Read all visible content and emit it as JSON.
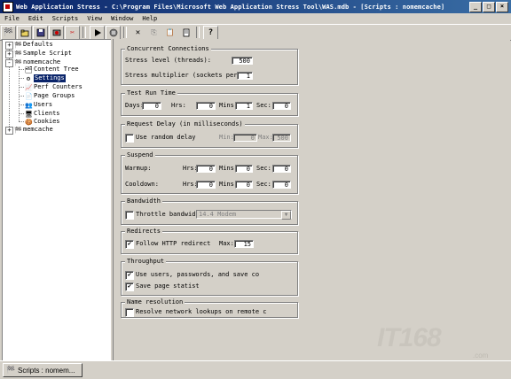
{
  "window": {
    "title": "Web Application Stress - C:\\Program Files\\Microsoft Web Application Stress Tool\\WAS.mdb - [Scripts : nomemcache]",
    "controls": [
      "_",
      "□",
      "×"
    ]
  },
  "menubar": {
    "items": [
      "File",
      "Edit",
      "Scripts",
      "View",
      "Window",
      "Help"
    ]
  },
  "toolbar": {
    "icons": [
      "new-script-icon",
      "open-icon",
      "save-icon",
      "record-icon",
      "cut-icon",
      "run-icon",
      "stop-icon",
      "delete-icon",
      "copy-icon",
      "paste-icon",
      "properties-icon",
      "help-icon"
    ]
  },
  "tree": {
    "items": [
      {
        "label": "Defaults",
        "level": 0,
        "expander": "+"
      },
      {
        "label": "Sample Script",
        "level": 0,
        "expander": "+"
      },
      {
        "label": "nomemcache",
        "level": 0,
        "expander": "-"
      },
      {
        "label": "Content Tree",
        "level": 1
      },
      {
        "label": "Settings",
        "level": 1,
        "selected": true
      },
      {
        "label": "Perf Counters",
        "level": 1
      },
      {
        "label": "Page Groups",
        "level": 1
      },
      {
        "label": "Users",
        "level": 1
      },
      {
        "label": "Clients",
        "level": 1
      },
      {
        "label": "Cookies",
        "level": 1
      },
      {
        "label": "memcache",
        "level": 0,
        "expander": "+"
      }
    ]
  },
  "settings": {
    "concurrent": {
      "title": "Concurrent Connections",
      "stress_label": "Stress level (threads):",
      "stress_value": "500",
      "multiplier_label": "Stress multiplier (sockets per",
      "multiplier_value": "1"
    },
    "runtime": {
      "title": "Test Run Time",
      "days_label": "Days:",
      "days": "0",
      "hrs_label": "Hrs:",
      "hrs": "0",
      "mins_label": "Mins:",
      "mins": "1",
      "sec_label": "Sec:",
      "sec": "0"
    },
    "delay": {
      "title": "Request Delay (in milliseconds)",
      "random_label": "Use random delay",
      "min_label": "Min:",
      "min": "0",
      "max_label": "Max:",
      "max": "500"
    },
    "suspend": {
      "title": "Suspend",
      "warmup_label": "Warmup:",
      "cooldown_label": "Cooldown:",
      "hrs_label": "Hrs:",
      "mins_label": "Mins:",
      "sec_label": "Sec:",
      "warmup": {
        "hrs": "0",
        "mins": "0",
        "sec": "0"
      },
      "cooldown": {
        "hrs": "0",
        "mins": "0",
        "sec": "0"
      }
    },
    "bandwidth": {
      "title": "Bandwidth",
      "throttle_label": "Throttle bandwid",
      "throttle_value": "14.4 Modem"
    },
    "redirects": {
      "title": "Redirects",
      "follow_label": "Follow HTTP redirect",
      "max_label": "Max:",
      "max_value": "15"
    },
    "throughput": {
      "title": "Throughput",
      "use_users_label": "Use users, passwords, and save co",
      "save_page_label": "Save page statist"
    },
    "name_resolution": {
      "title": "Name resolution",
      "resolve_label": "Resolve network lookups on remote c"
    }
  },
  "statusbar": {
    "task_label": "Scripts : nomem..."
  },
  "watermark": {
    "brand": "IT168",
    "domain": ".com"
  }
}
